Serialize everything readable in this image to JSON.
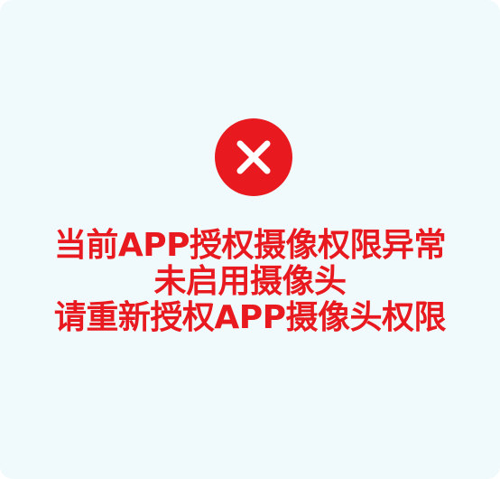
{
  "dialog": {
    "icon": "close-circle-icon",
    "accent_color": "#e81a1f",
    "background_color": "#f0fafc",
    "message_lines": [
      "当前APP授权摄像权限异常",
      "未启用摄像头",
      "请重新授权APP摄像头权限"
    ]
  }
}
